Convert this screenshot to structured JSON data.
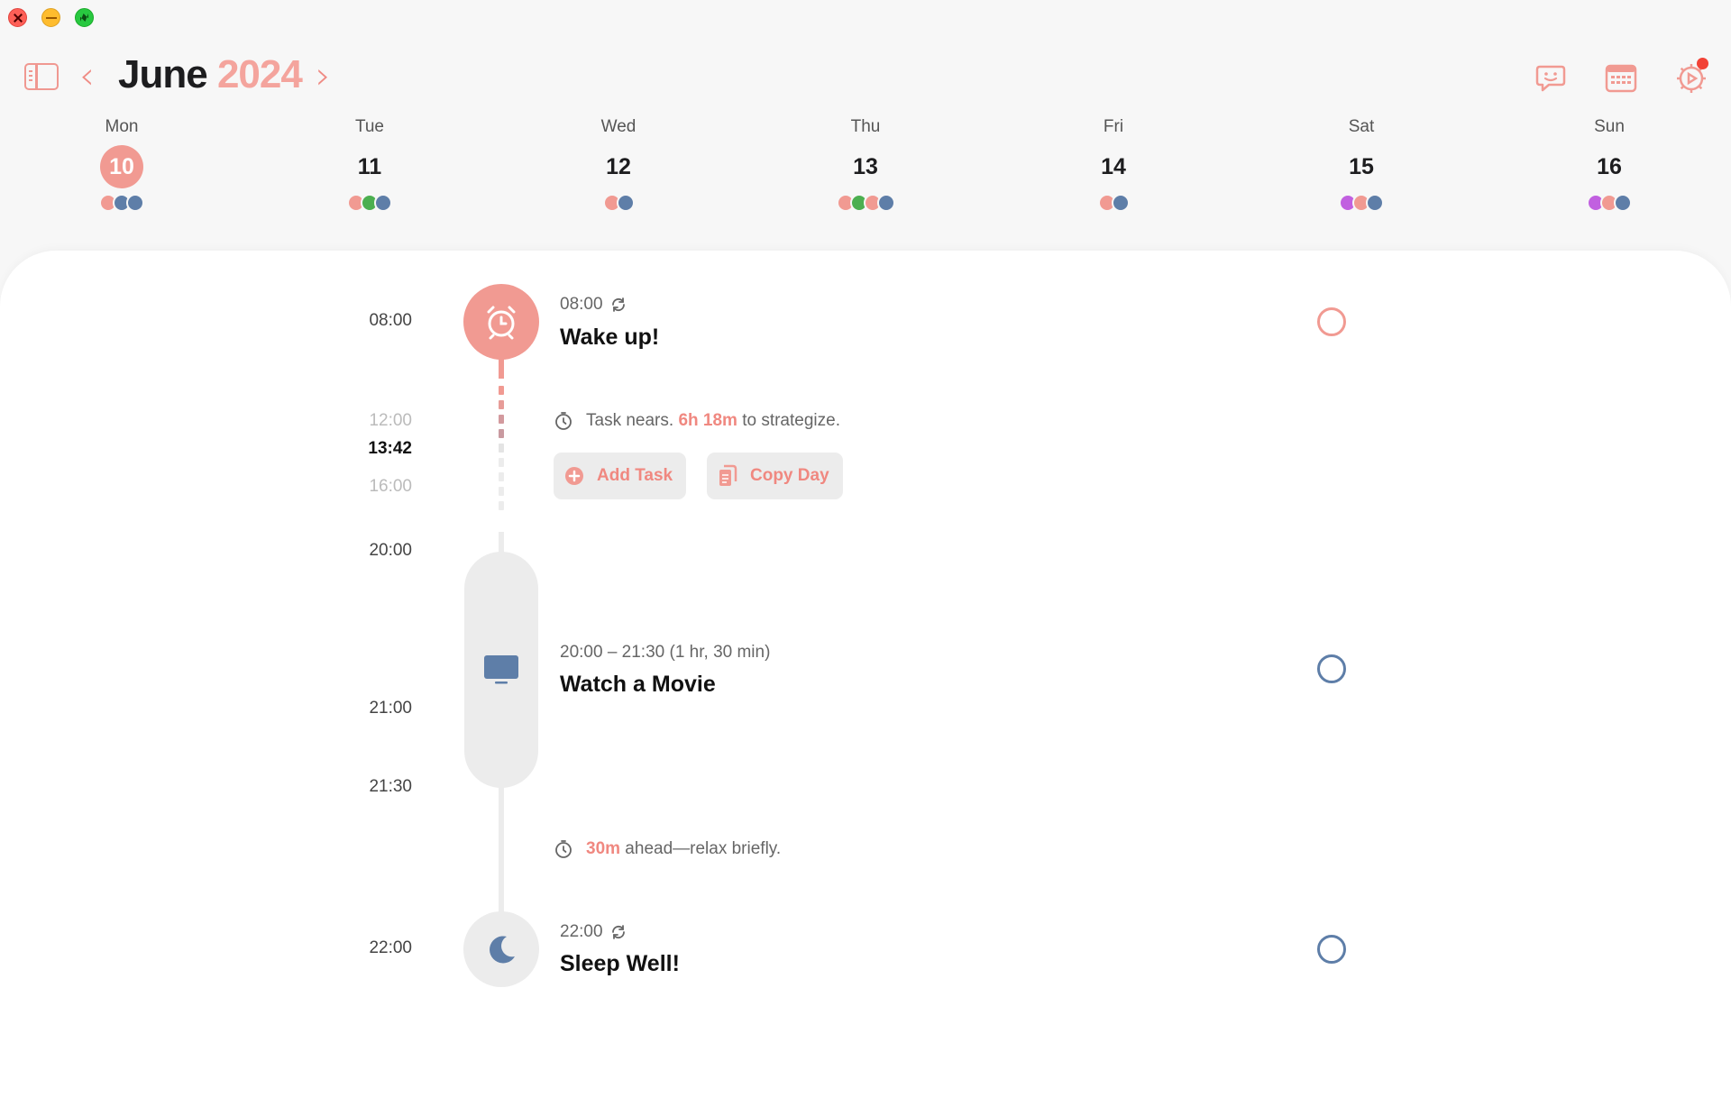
{
  "colors": {
    "accent": "#f19a92",
    "accent_text": "#f08880",
    "night_blue": "#5e7ea8",
    "green": "#4caf50",
    "purple": "#c160e0",
    "track": "#ececec"
  },
  "window": {
    "controls": [
      "close",
      "minimize",
      "zoom"
    ]
  },
  "header": {
    "month": "June",
    "year": "2024",
    "icons": [
      "sidebar-toggle-icon",
      "chevron-left-icon",
      "chevron-right-icon",
      "feedback-icon",
      "calendar-icon",
      "settings-icon"
    ],
    "settings_has_notification": true
  },
  "week": [
    {
      "name": "Mon",
      "num": "10",
      "today": true,
      "dots": [
        "#f19a92",
        "#5e7ea8",
        "#5e7ea8"
      ]
    },
    {
      "name": "Tue",
      "num": "11",
      "today": false,
      "dots": [
        "#f19a92",
        "#4caf50",
        "#5e7ea8"
      ]
    },
    {
      "name": "Wed",
      "num": "12",
      "today": false,
      "dots": [
        "#f19a92",
        "#5e7ea8"
      ]
    },
    {
      "name": "Thu",
      "num": "13",
      "today": false,
      "dots": [
        "#f19a92",
        "#4caf50",
        "#f19a92",
        "#5e7ea8"
      ]
    },
    {
      "name": "Fri",
      "num": "14",
      "today": false,
      "dots": [
        "#f19a92",
        "#5e7ea8"
      ]
    },
    {
      "name": "Sat",
      "num": "15",
      "today": false,
      "dots": [
        "#c160e0",
        "#f19a92",
        "#5e7ea8"
      ]
    },
    {
      "name": "Sun",
      "num": "16",
      "today": false,
      "dots": [
        "#c160e0",
        "#f19a92",
        "#5e7ea8"
      ]
    }
  ],
  "timeline": {
    "labels": {
      "t0800": "08:00",
      "t1200": "12:00",
      "now": "13:42",
      "t1600": "16:00",
      "t2000": "20:00",
      "t2100": "21:00",
      "t2130": "21:30",
      "t2200": "22:00"
    },
    "events": {
      "wake": {
        "time": "08:00",
        "title": "Wake up!",
        "icon": "alarm-clock-icon",
        "repeats": true,
        "done": false
      },
      "movie": {
        "time": "20:00 – 21:30 (1 hr, 30 min)",
        "title": "Watch a Movie",
        "icon": "tv-icon",
        "done": false
      },
      "sleep": {
        "time": "22:00",
        "title": "Sleep Well!",
        "icon": "moon-icon",
        "repeats": true,
        "done": false
      }
    },
    "gap1": {
      "pre": "Task nears. ",
      "highlight": "6h 18m",
      "post": " to strategize."
    },
    "gap2": {
      "pre": "",
      "highlight": "30m",
      "post": " ahead—relax briefly."
    },
    "buttons": {
      "add_task": "Add Task",
      "copy_day": "Copy Day"
    }
  }
}
